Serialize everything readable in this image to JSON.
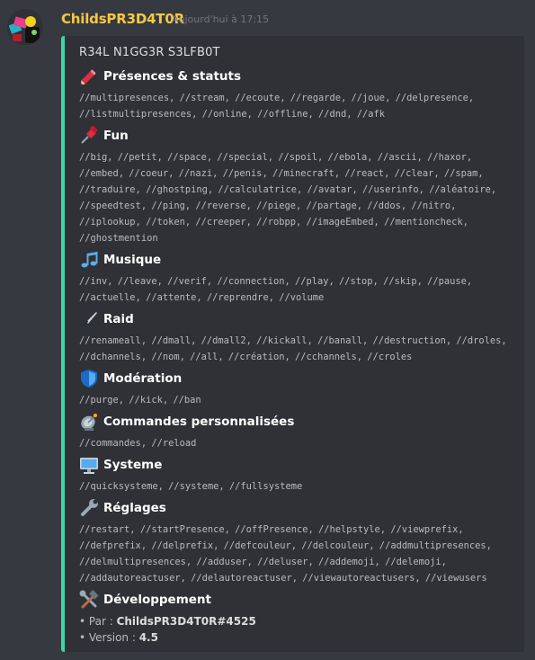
{
  "message": {
    "username": "ChildsPR3D4T0R",
    "timestamp": "Aujourd'hui à 17:15"
  },
  "embed": {
    "accent_color": "#39d9a3",
    "title": "R34L N1GG3R S3LFB0T",
    "sections": [
      {
        "icon": "pencil-icon",
        "name": "Présences & statuts",
        "cmds": "//multipresences, //stream, //ecoute, //regarde, //joue, //delpresence,\n//listmultipresences, //online, //offline, //dnd, //afk"
      },
      {
        "icon": "pushpin-icon",
        "name": "Fun",
        "cmds": "//big, //petit, //space, //special, //spoil, //ebola, //ascii, //haxor,\n//embed, //coeur, //nazi, //penis, //minecraft, //react, //clear, //spam,\n//traduire, //ghostping, //calculatrice, //avatar, //userinfo, //aléatoire,\n//speedtest, //ping, //reverse, //piege, //partage, //ddos, //nitro,\n//iplookup, //token, //creeper, //robpp, //imageEmbed, //mentioncheck,\n//ghostmention"
      },
      {
        "icon": "musical-notes-icon",
        "name": "Musique",
        "cmds": "//inv, //leave, //verif, //connection, //play, //stop, //skip, //pause,\n//actuelle, //attente, //reprendre, //volume"
      },
      {
        "icon": "knife-icon",
        "name": "Raid",
        "cmds": "//renameall, //dmall, //dmall2, //kickall, //banall, //destruction, //droles,\n//dchannels, //nom, //all, //création, //cchannels, //croles"
      },
      {
        "icon": "shield-icon",
        "name": "Modération",
        "cmds": "//purge, //kick, //ban"
      },
      {
        "icon": "satellite-icon",
        "name": "Commandes personnalisées",
        "cmds": "//commandes, //reload"
      },
      {
        "icon": "computer-icon",
        "name": "Systeme",
        "cmds": "//quicksysteme, //systeme, //fullsysteme"
      },
      {
        "icon": "wrench-icon",
        "name": "Réglages",
        "cmds": "//restart, //startPresence, //offPresence, //helpstyle, //viewprefix,\n//defprefix, //delprefix, //defcouleur, //delcouleur, //addmultipresences,\n//delmultipresences, //adduser, //deluser, //addemoji, //delemoji,\n//addautoreactuser, //delautoreactuser, //viewautoreactusers, //viewusers"
      },
      {
        "icon": "hammer-and-wrench-icon",
        "name": "Développement",
        "cmds": ""
      }
    ],
    "footer": {
      "par_label": "• Par : ",
      "par_value": "ChildsPR3D4T0R#4525",
      "version_label": "• Version : ",
      "version_value": "4.5"
    }
  }
}
